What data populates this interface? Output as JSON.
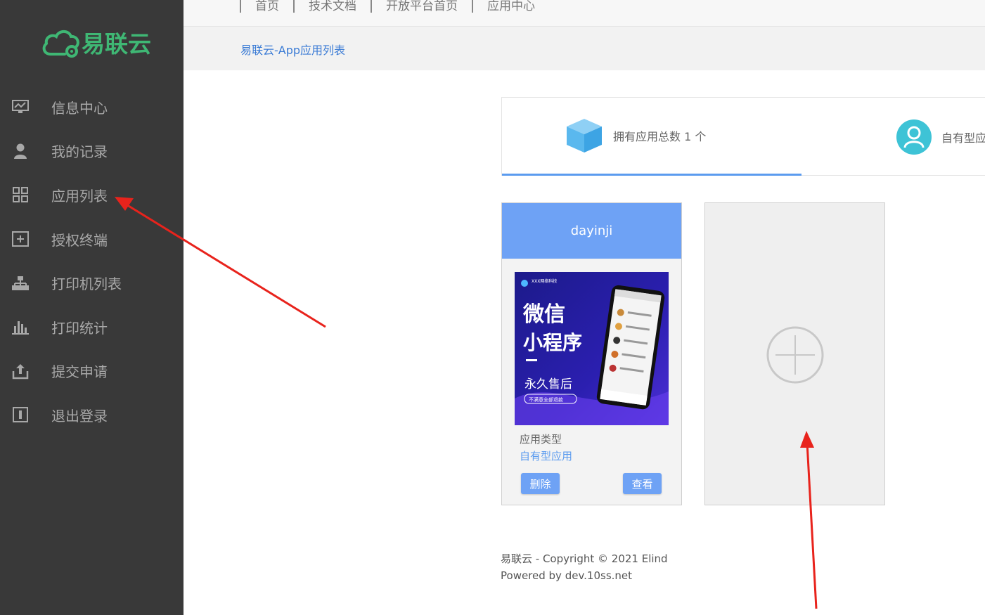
{
  "brand": {
    "logo_text": "易联云",
    "color": "#3fb774"
  },
  "sidebar": {
    "items": [
      {
        "label": "信息中心",
        "icon": "monitor-icon"
      },
      {
        "label": "我的记录",
        "icon": "user-icon"
      },
      {
        "label": "应用列表",
        "icon": "grid-icon"
      },
      {
        "label": "授权终端",
        "icon": "plus-box-icon"
      },
      {
        "label": "打印机列表",
        "icon": "sitemap-icon"
      },
      {
        "label": "打印统计",
        "icon": "bar-chart-icon"
      },
      {
        "label": "提交申请",
        "icon": "upload-icon"
      },
      {
        "label": "退出登录",
        "icon": "logout-icon"
      }
    ]
  },
  "topnav": {
    "links": [
      "首页",
      "技术文档",
      "开放平台首页",
      "应用中心"
    ]
  },
  "breadcrumb": "易联云-App应用列表",
  "stats": {
    "total_apps_label": "拥有应用总数 1 个",
    "own_type_label": "自有型应用"
  },
  "app_card": {
    "name": "dayinji",
    "thumb": {
      "company": "XXX网络科技",
      "line1": "微信",
      "line2": "小程序",
      "line3": "永久售后",
      "badge": "不满意全部退款"
    },
    "type_label": "应用类型",
    "type_value": "自有型应用",
    "delete_label": "删除",
    "view_label": "查看"
  },
  "footer": {
    "line1": "易联云 - Copyright © 2021 Elind",
    "line2": "Powered by dev.10ss.net"
  },
  "colors": {
    "sidebar_bg": "#393939",
    "accent": "#6ea2f5",
    "annotation": "#e8231c"
  }
}
